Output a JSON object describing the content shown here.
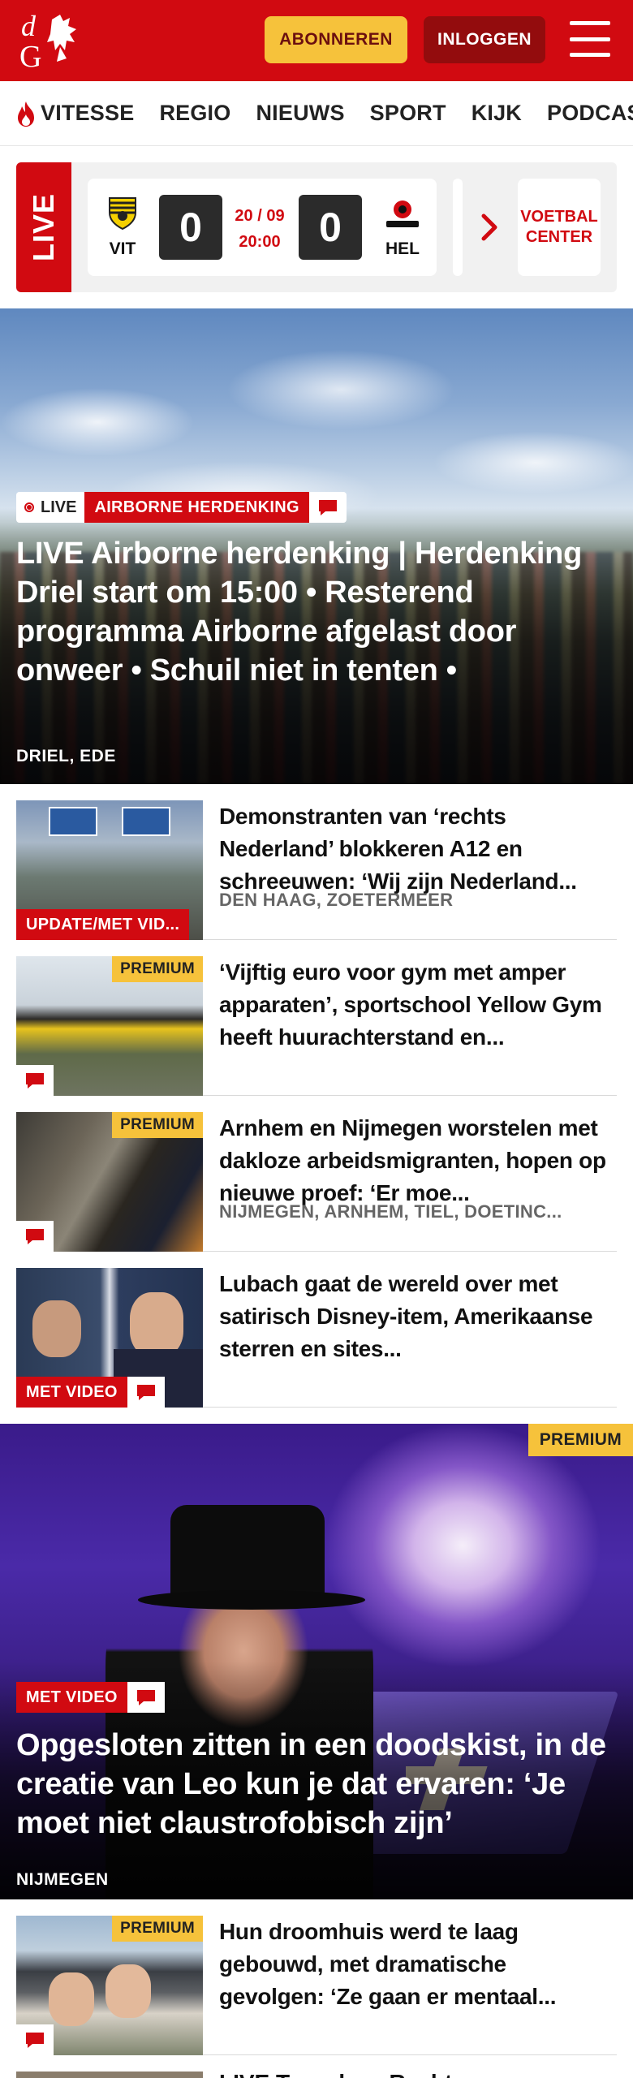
{
  "header": {
    "logo_text": "dG",
    "subscribe_label": "ABONNEREN",
    "login_label": "INLOGGEN"
  },
  "nav": {
    "items": [
      {
        "label": "VITESSE",
        "icon": "flame-icon"
      },
      {
        "label": "REGIO"
      },
      {
        "label": "NIEUWS"
      },
      {
        "label": "SPORT"
      },
      {
        "label": "KIJK"
      },
      {
        "label": "PODCAST"
      }
    ]
  },
  "live_bar": {
    "live_label": "LIVE",
    "match": {
      "home_code": "VIT",
      "away_code": "HEL",
      "home_score": "0",
      "away_score": "0",
      "date": "20 / 09",
      "time": "20:00"
    },
    "voetbal_center_label": "VOETBAL CENTER"
  },
  "hero": {
    "live_label": "LIVE",
    "category": "AIRBORNE HERDENKING",
    "title": "LIVE Airborne herdenking | Herdenking Driel start om 15:00 • Resterend programma Airborne afgelast door onweer • Schuil niet in tenten •",
    "location": "DRIEL, EDE"
  },
  "articles": [
    {
      "headline": "Demonstranten van ‘rechts Nederland’ blokkeren A12 en schreeuwen: ‘Wij zijn Nederland...",
      "meta": "DEN HAAG, ZOETERMEER",
      "badge": "UPDATE/MET VID...",
      "premium": ""
    },
    {
      "headline": "‘Vijftig euro voor gym met amper apparaten’, sportschool Yellow Gym heeft huurachterstand en...",
      "meta": "",
      "badge": "",
      "premium": "PREMIUM"
    },
    {
      "headline": "Arnhem en Nijmegen worstelen met dakloze arbeidsmigranten, hopen op nieuwe proef: ‘Er moe...",
      "meta": "NIJMEGEN, ARNHEM, TIEL, DOETINC...",
      "badge": "",
      "premium": "PREMIUM"
    },
    {
      "headline": "Lubach gaat de wereld over met satirisch Disney-item, Amerikaanse sterren en sites...",
      "meta": "",
      "badge": "MET VIDEO",
      "premium": ""
    }
  ],
  "feature": {
    "premium": "PREMIUM",
    "badge": "MET VIDEO",
    "title": "Opgesloten zitten in een doodskist, in de creatie van Leo kun je dat ervaren: ‘Je moet niet claustrofobisch zijn’",
    "location": "NIJMEGEN"
  },
  "articles2": [
    {
      "headline": "Hun droomhuis werd te laag gebouwd, met dramatische gevolgen: ‘Ze gaan er mentaal...",
      "premium": "PREMIUM"
    }
  ],
  "partial": {
    "headline": "LIVE Tweede ... Rechter..."
  },
  "colors": {
    "brand_red": "#d10a11",
    "premium_yellow": "#f6c23b",
    "login_dark_red": "#930c0d"
  }
}
